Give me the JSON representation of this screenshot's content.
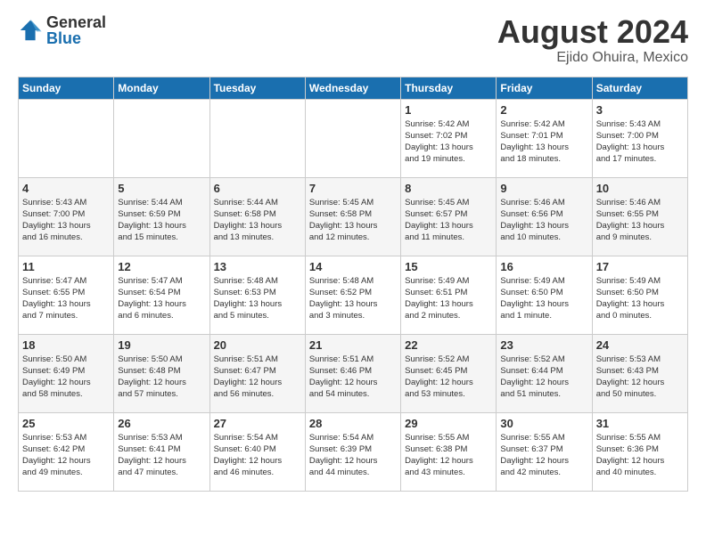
{
  "logo": {
    "general": "General",
    "blue": "Blue"
  },
  "title": {
    "month_year": "August 2024",
    "location": "Ejido Ohuira, Mexico"
  },
  "headers": [
    "Sunday",
    "Monday",
    "Tuesday",
    "Wednesday",
    "Thursday",
    "Friday",
    "Saturday"
  ],
  "weeks": [
    [
      {
        "day": "",
        "info": ""
      },
      {
        "day": "",
        "info": ""
      },
      {
        "day": "",
        "info": ""
      },
      {
        "day": "",
        "info": ""
      },
      {
        "day": "1",
        "info": "Sunrise: 5:42 AM\nSunset: 7:02 PM\nDaylight: 13 hours\nand 19 minutes."
      },
      {
        "day": "2",
        "info": "Sunrise: 5:42 AM\nSunset: 7:01 PM\nDaylight: 13 hours\nand 18 minutes."
      },
      {
        "day": "3",
        "info": "Sunrise: 5:43 AM\nSunset: 7:00 PM\nDaylight: 13 hours\nand 17 minutes."
      }
    ],
    [
      {
        "day": "4",
        "info": "Sunrise: 5:43 AM\nSunset: 7:00 PM\nDaylight: 13 hours\nand 16 minutes."
      },
      {
        "day": "5",
        "info": "Sunrise: 5:44 AM\nSunset: 6:59 PM\nDaylight: 13 hours\nand 15 minutes."
      },
      {
        "day": "6",
        "info": "Sunrise: 5:44 AM\nSunset: 6:58 PM\nDaylight: 13 hours\nand 13 minutes."
      },
      {
        "day": "7",
        "info": "Sunrise: 5:45 AM\nSunset: 6:58 PM\nDaylight: 13 hours\nand 12 minutes."
      },
      {
        "day": "8",
        "info": "Sunrise: 5:45 AM\nSunset: 6:57 PM\nDaylight: 13 hours\nand 11 minutes."
      },
      {
        "day": "9",
        "info": "Sunrise: 5:46 AM\nSunset: 6:56 PM\nDaylight: 13 hours\nand 10 minutes."
      },
      {
        "day": "10",
        "info": "Sunrise: 5:46 AM\nSunset: 6:55 PM\nDaylight: 13 hours\nand 9 minutes."
      }
    ],
    [
      {
        "day": "11",
        "info": "Sunrise: 5:47 AM\nSunset: 6:55 PM\nDaylight: 13 hours\nand 7 minutes."
      },
      {
        "day": "12",
        "info": "Sunrise: 5:47 AM\nSunset: 6:54 PM\nDaylight: 13 hours\nand 6 minutes."
      },
      {
        "day": "13",
        "info": "Sunrise: 5:48 AM\nSunset: 6:53 PM\nDaylight: 13 hours\nand 5 minutes."
      },
      {
        "day": "14",
        "info": "Sunrise: 5:48 AM\nSunset: 6:52 PM\nDaylight: 13 hours\nand 3 minutes."
      },
      {
        "day": "15",
        "info": "Sunrise: 5:49 AM\nSunset: 6:51 PM\nDaylight: 13 hours\nand 2 minutes."
      },
      {
        "day": "16",
        "info": "Sunrise: 5:49 AM\nSunset: 6:50 PM\nDaylight: 13 hours\nand 1 minute."
      },
      {
        "day": "17",
        "info": "Sunrise: 5:49 AM\nSunset: 6:50 PM\nDaylight: 13 hours\nand 0 minutes."
      }
    ],
    [
      {
        "day": "18",
        "info": "Sunrise: 5:50 AM\nSunset: 6:49 PM\nDaylight: 12 hours\nand 58 minutes."
      },
      {
        "day": "19",
        "info": "Sunrise: 5:50 AM\nSunset: 6:48 PM\nDaylight: 12 hours\nand 57 minutes."
      },
      {
        "day": "20",
        "info": "Sunrise: 5:51 AM\nSunset: 6:47 PM\nDaylight: 12 hours\nand 56 minutes."
      },
      {
        "day": "21",
        "info": "Sunrise: 5:51 AM\nSunset: 6:46 PM\nDaylight: 12 hours\nand 54 minutes."
      },
      {
        "day": "22",
        "info": "Sunrise: 5:52 AM\nSunset: 6:45 PM\nDaylight: 12 hours\nand 53 minutes."
      },
      {
        "day": "23",
        "info": "Sunrise: 5:52 AM\nSunset: 6:44 PM\nDaylight: 12 hours\nand 51 minutes."
      },
      {
        "day": "24",
        "info": "Sunrise: 5:53 AM\nSunset: 6:43 PM\nDaylight: 12 hours\nand 50 minutes."
      }
    ],
    [
      {
        "day": "25",
        "info": "Sunrise: 5:53 AM\nSunset: 6:42 PM\nDaylight: 12 hours\nand 49 minutes."
      },
      {
        "day": "26",
        "info": "Sunrise: 5:53 AM\nSunset: 6:41 PM\nDaylight: 12 hours\nand 47 minutes."
      },
      {
        "day": "27",
        "info": "Sunrise: 5:54 AM\nSunset: 6:40 PM\nDaylight: 12 hours\nand 46 minutes."
      },
      {
        "day": "28",
        "info": "Sunrise: 5:54 AM\nSunset: 6:39 PM\nDaylight: 12 hours\nand 44 minutes."
      },
      {
        "day": "29",
        "info": "Sunrise: 5:55 AM\nSunset: 6:38 PM\nDaylight: 12 hours\nand 43 minutes."
      },
      {
        "day": "30",
        "info": "Sunrise: 5:55 AM\nSunset: 6:37 PM\nDaylight: 12 hours\nand 42 minutes."
      },
      {
        "day": "31",
        "info": "Sunrise: 5:55 AM\nSunset: 6:36 PM\nDaylight: 12 hours\nand 40 minutes."
      }
    ]
  ]
}
